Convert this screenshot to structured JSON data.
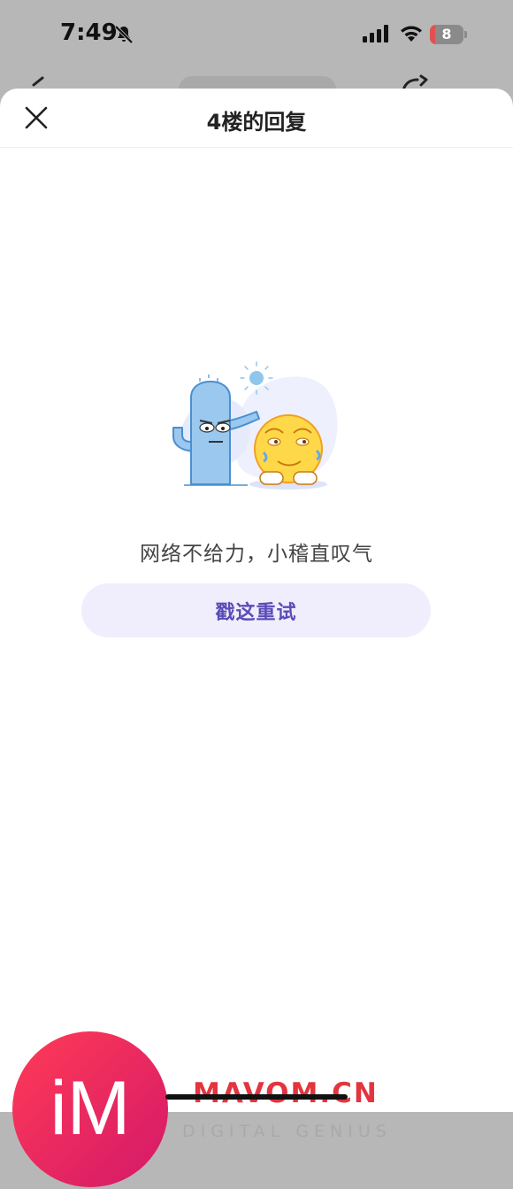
{
  "status_bar": {
    "time": "7:49",
    "battery": "8",
    "battery_level": 0.08,
    "icons": [
      "bell-off-icon",
      "cellular-signal-icon",
      "wifi-icon",
      "battery-icon"
    ]
  },
  "sheet": {
    "title": "4楼的回复",
    "close_icon": "close-icon"
  },
  "empty_state": {
    "message": "网络不给力，小稽直叹气",
    "retry_label": "戳这重试",
    "illustration": "cactus-and-emoji-illustration"
  },
  "watermark": {
    "logo_text": "iM",
    "brand": "MAVOM.CN",
    "subtitle": "DIGITAL GENIUS"
  },
  "colors": {
    "accent": "#5a4cb8",
    "button_bg": "#f0eefc",
    "watermark_red": "#e3353f",
    "battery_low": "#e05252"
  }
}
